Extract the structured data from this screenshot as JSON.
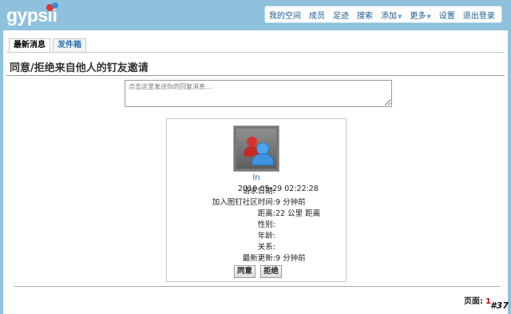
{
  "header": {
    "logo_text": "gypsii",
    "nav": [
      {
        "label": "我的空间",
        "caret": false
      },
      {
        "label": "成员",
        "caret": false
      },
      {
        "label": "足迹",
        "caret": false
      },
      {
        "label": "搜索",
        "caret": false
      },
      {
        "label": "添加",
        "caret": true
      },
      {
        "label": "更多",
        "caret": true
      },
      {
        "label": "设置",
        "caret": false
      },
      {
        "label": "退出登录",
        "caret": false
      }
    ]
  },
  "tabs": [
    {
      "label": "最新消息",
      "active": true
    },
    {
      "label": "发件箱",
      "active": false
    }
  ],
  "page_title": "同意/拒绝来自他人的钉友邀请",
  "reply": {
    "placeholder": "点击这里发送你的回复消息..."
  },
  "request": {
    "username": "ln",
    "details": [
      {
        "label": "请求日期:",
        "value": "2010-05-29 02:22:28"
      },
      {
        "label": "加入图钉社区时间:",
        "value": "9 分钟前"
      },
      {
        "label": "距离:",
        "value": "22 公里 距离"
      },
      {
        "label": "性别:",
        "value": ""
      },
      {
        "label": "年龄:",
        "value": ""
      },
      {
        "label": "关系:",
        "value": ""
      },
      {
        "label": "最新更新:",
        "value": "9 分钟前"
      }
    ],
    "accept_label": "同意",
    "reject_label": "拒绝"
  },
  "pager": {
    "label": "页面:",
    "current": "1"
  },
  "stamp": "#37"
}
